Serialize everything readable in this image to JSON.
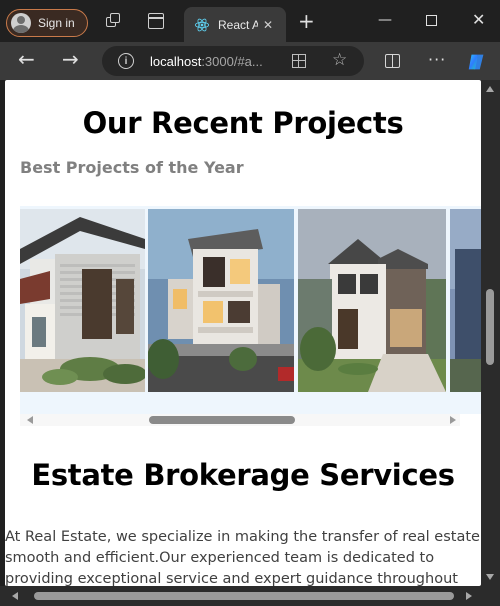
{
  "browser": {
    "sign_in_label": "Sign in",
    "tab_title": "React A",
    "tab_close_glyph": "✕",
    "new_tab_glyph": "+",
    "window": {
      "minimize": "—",
      "close": "✕"
    },
    "address": {
      "host": "localhost",
      "rest": ":3000/#a..."
    },
    "icons": {
      "profile": "avatar-icon",
      "workspaces": "workspaces-icon",
      "tab_actions": "tab-actions-icon",
      "tab_favicon": "react-icon",
      "back": "back-arrow-icon",
      "forward": "forward-arrow-icon",
      "site_info": "info-icon",
      "apps": "apps-icon",
      "favorite": "star-icon",
      "split_screen": "split-screen-icon",
      "more": "more-icon",
      "copilot": "copilot-icon"
    },
    "colors": {
      "frame": "#202020",
      "toolbar": "#3a3a3a",
      "signin_border": "#c97a4a"
    }
  },
  "page": {
    "projects_heading": "Our Recent Projects",
    "projects_subheading": "Best Projects of the Year",
    "gallery": {
      "images": [
        "project-photo-1",
        "project-photo-2",
        "project-photo-3",
        "project-photo-4"
      ],
      "background": "#eef6fd"
    },
    "services_heading": "Estate Brokerage Services",
    "services_text": "At Real Estate, we specialize in making the transfer of real estate smooth and efficient.Our experienced team is dedicated to providing exceptional service and expert guidance throughout"
  }
}
